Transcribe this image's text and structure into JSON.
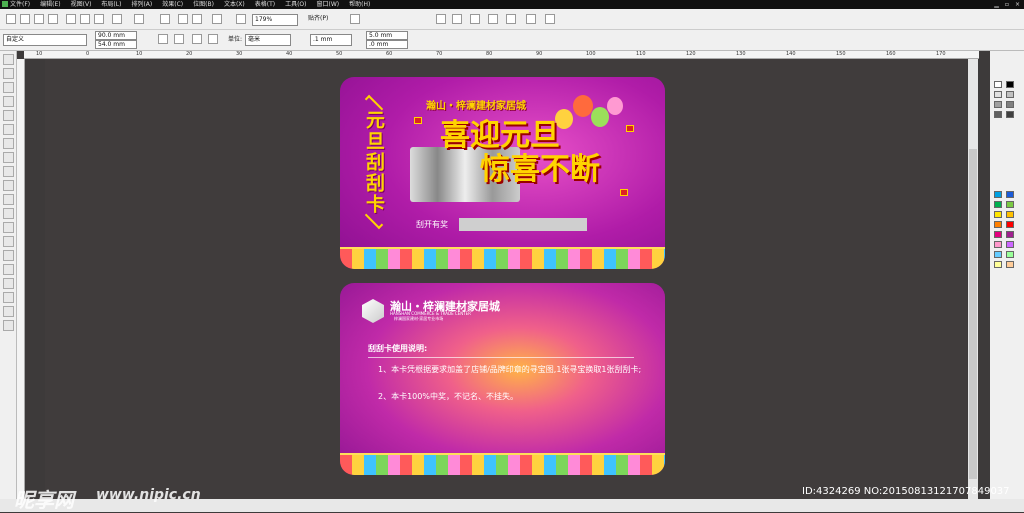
{
  "menu": [
    "文件(F)",
    "编辑(E)",
    "视图(V)",
    "布局(L)",
    "排列(A)",
    "效果(C)",
    "位图(B)",
    "文本(X)",
    "表格(T)",
    "工具(O)",
    "窗口(W)",
    "帮助(H)"
  ],
  "toolbar": {
    "zoom": "179%",
    "snap_label": "贴齐(P)"
  },
  "property_bar": {
    "preset": "自定义",
    "width": "90.0 mm",
    "height": "54.0 mm",
    "unit_label": "单位:",
    "unit": "毫米",
    "nudge": ".1 mm",
    "dup_x": "5.0 mm",
    "dup_y": ".0 mm"
  },
  "ruler_ticks": [
    "10",
    "0",
    "10",
    "20",
    "30",
    "40",
    "50",
    "60",
    "70",
    "80",
    "90",
    "100",
    "110",
    "120",
    "130",
    "140",
    "150",
    "160",
    "170"
  ],
  "card_front": {
    "vertical_title": "元旦刮刮卡",
    "subtitle": "瀚山・梓澜建材家居城",
    "headline_1": "喜迎元旦",
    "headline_2": "惊喜不断",
    "scratch_label": "刮开有奖"
  },
  "card_back": {
    "logo_cn": "瀚山・梓澜建材家居城",
    "logo_en": "HANSHAN COMMERCE & TRADE CENTER",
    "logo_sub": "梓澜国家建材·家居专业市场",
    "instructions_title": "刮刮卡使用说明:",
    "instructions": [
      "1、本卡凭根据要求加盖了店铺/品牌印章的寻宝图,1张寻宝换取1张刮刮卡;",
      "2、本卡100%中奖，不记名、不挂失。"
    ]
  },
  "watermark": {
    "logo": "昵享网",
    "url": "www.nipic.cn",
    "id_text": "ID:4324269 NO:20150813121707849037"
  },
  "colors": {
    "canvas": "#3d3a3a",
    "accent": "#ffd400",
    "card_purple": "#b01ca8"
  }
}
